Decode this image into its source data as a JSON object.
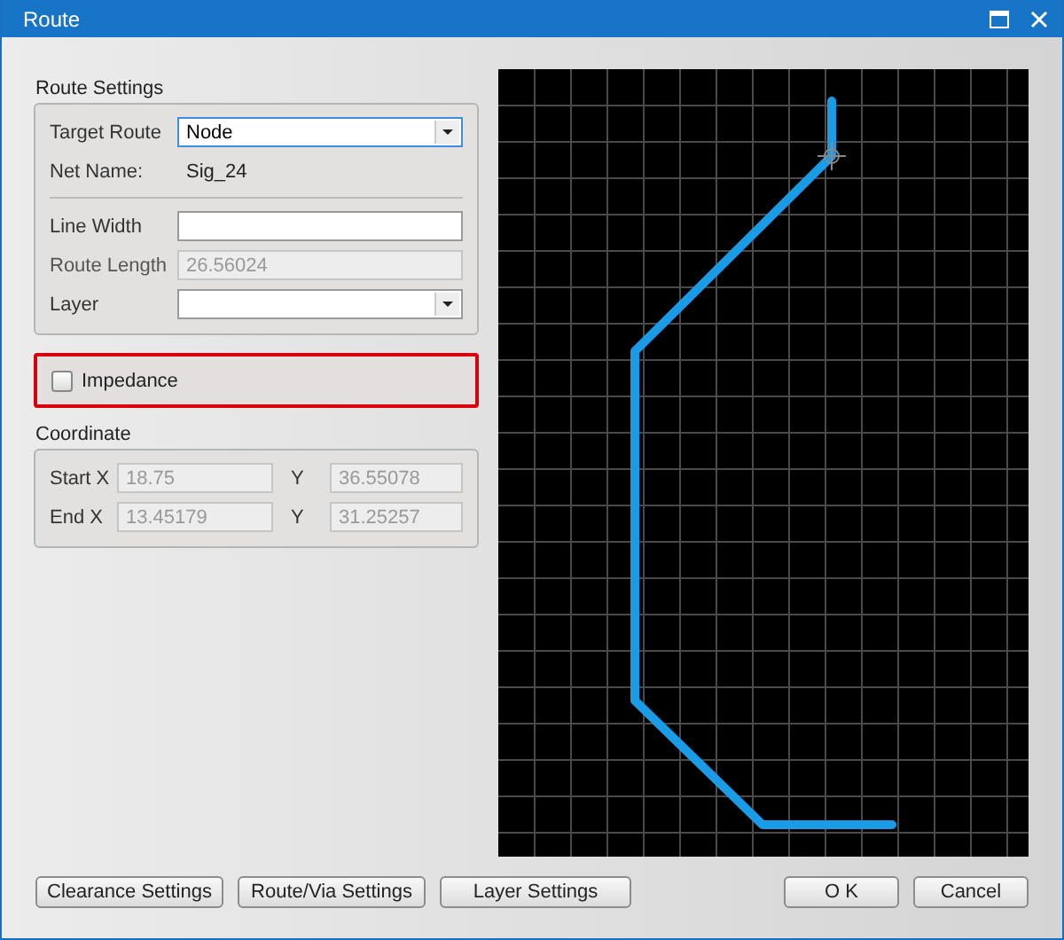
{
  "window": {
    "title": "Route"
  },
  "route_settings": {
    "title": "Route Settings",
    "target_route": {
      "label": "Target Route",
      "value": "Node"
    },
    "net_name": {
      "label": "Net Name:",
      "value": "Sig_24"
    },
    "line_width": {
      "label": "Line Width"
    },
    "route_length": {
      "label": "Route Length",
      "value": "26.56024",
      "disabled": true
    },
    "layer": {
      "label": "Layer"
    }
  },
  "impedance": {
    "label": "Impedance",
    "checked": false
  },
  "coordinate": {
    "title": "Coordinate",
    "rows": [
      {
        "x_label": "Start X",
        "x_value": "18.75",
        "y_label": "Y",
        "y_value": "36.55078"
      },
      {
        "x_label": "End X",
        "x_value": "13.45179",
        "y_label": "Y",
        "y_value": "31.25257"
      }
    ]
  },
  "buttons_left": [
    "Clearance Settings",
    "Route/Via Settings",
    "Layer Settings"
  ],
  "buttons_right": [
    "O K",
    "Cancel"
  ]
}
